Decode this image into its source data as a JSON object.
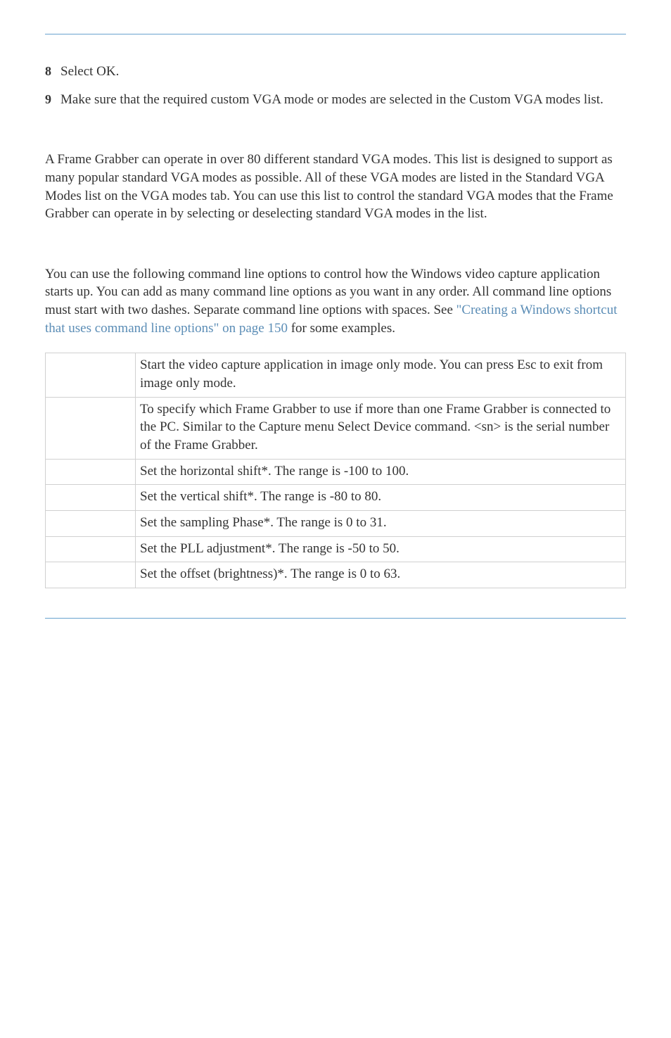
{
  "list": {
    "items": [
      {
        "num": "8",
        "text": "Select OK."
      },
      {
        "num": "9",
        "text": "Make sure that the required custom VGA mode or modes are selected in the Custom VGA modes list."
      }
    ]
  },
  "para1": "A Frame Grabber can operate in over 80 different standard VGA modes. This list is designed to support as many popular standard VGA modes as possible. All of these VGA modes are listed in the Standard VGA Modes list on the VGA modes tab. You can use this list to control the standard VGA modes that the Frame Grabber can operate in by selecting or deselecting standard VGA modes in the list.",
  "para2_pre": "You can use the following command line options to control how the Windows video capture application starts up. You can add as many command line options as you want in any order. All command line options must start with two dashes. Separate command line options with spaces. See ",
  "para2_link": "\"Creating a Windows shortcut that uses command line options\" on page 150",
  "para2_post": " for some examples.",
  "table": {
    "rows": [
      {
        "desc": "Start the video capture application in image only mode. You can press Esc to exit from image only mode."
      },
      {
        "desc": "To specify which Frame Grabber to use if more than one Frame Grabber is connected to the PC. Similar to the Capture menu Select Device command. <sn> is the serial number of the Frame Grabber."
      },
      {
        "desc": "Set the horizontal shift*. The range is -100 to 100."
      },
      {
        "desc": "Set the vertical shift*. The range is -80 to 80."
      },
      {
        "desc": "Set the sampling Phase*. The range is 0 to 31."
      },
      {
        "desc": "Set the PLL adjustment*. The range is -50 to 50."
      },
      {
        "desc": "Set the offset (brightness)*. The range is 0 to 63."
      }
    ]
  }
}
